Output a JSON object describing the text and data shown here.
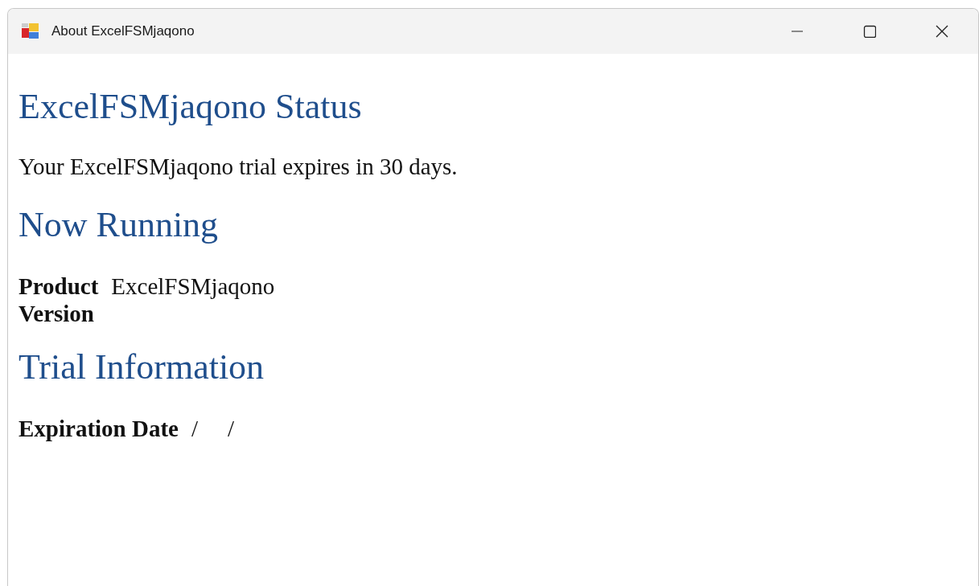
{
  "window": {
    "title": "About ExcelFSMjaqono"
  },
  "sections": [
    {
      "kind": "heading",
      "text": "ExcelFSMjaqono Status"
    },
    {
      "kind": "paragraph",
      "text": "Your ExcelFSMjaqono trial expires in 30 days."
    },
    {
      "kind": "heading",
      "text": "Now Running"
    },
    {
      "kind": "fields",
      "rows": [
        {
          "label": "Product",
          "value": "ExcelFSMjaqono"
        },
        {
          "label": "Version"
        }
      ]
    },
    {
      "kind": "heading",
      "text": "Trial Information"
    },
    {
      "kind": "fields",
      "rows": [
        {
          "label": "Expiration Date",
          "value": "/    /"
        }
      ]
    }
  ]
}
